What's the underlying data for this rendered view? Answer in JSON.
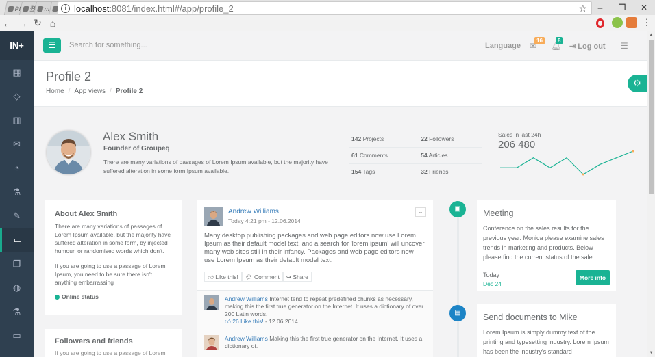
{
  "browser": {
    "tabs": [
      "PI",
      "登",
      "m",
      "M",
      "R",
      "R",
      "R",
      "re",
      "G",
      "器",
      "亞",
      "lo",
      "用",
      "才",
      "[",
      "P",
      "b",
      "1",
      "sc",
      "pi",
      "lo",
      "lo",
      "b",
      "b",
      "4",
      "IN",
      "IN",
      "In",
      "In",
      "IN",
      "In",
      "In",
      "Ir",
      "登"
    ],
    "active_tab_close": "×",
    "url_host": "localhost",
    "url_rest_port": ":8081",
    "url_path": "/index.html#/app/profile_2"
  },
  "app": {
    "logo": "IN+",
    "search_placeholder": "Search for something...",
    "language": "Language",
    "mail_count": "16",
    "bell_count": "8",
    "logout": "Log out"
  },
  "page": {
    "title": "Profile 2",
    "breadcrumb": [
      "Home",
      "App views",
      "Profile 2"
    ]
  },
  "profile": {
    "name": "Alex Smith",
    "role": "Founder of Groupeq",
    "description": "There are many variations of passages of Lorem Ipsum available, but the majority have suffered alteration in some form Ipsum available.",
    "stats": [
      {
        "num": "142",
        "label": "Projects"
      },
      {
        "num": "22",
        "label": "Followers"
      },
      {
        "num": "61",
        "label": "Comments"
      },
      {
        "num": "54",
        "label": "Articles"
      },
      {
        "num": "154",
        "label": "Tags"
      },
      {
        "num": "32",
        "label": "Friends"
      }
    ],
    "sales_label": "Sales in last 24h",
    "sales_value": "206 480"
  },
  "sparkline": {
    "values": [
      5,
      5,
      8,
      5,
      8,
      3,
      6,
      8,
      10
    ]
  },
  "about": {
    "title": "About Alex Smith",
    "p1": "There are many variations of passages of Lorem Ipsum available, but the majority have suffered alteration in some form, by injected humour, or randomised words which don't.",
    "p2": "If you are going to use a passage of Lorem Ipsum, you need to be sure there isn't anything embarrassing",
    "status": "Online status"
  },
  "followers": {
    "title": "Followers and friends",
    "text": "If you are going to use a passage of Lorem"
  },
  "post": {
    "author": "Andrew Williams",
    "time": "Today 4:21 pm - 12.06.2014",
    "body": "Many desktop publishing packages and web page editors now use Lorem Ipsum as their default model text, and a search for 'lorem ipsum' will uncover many web sites still in their infancy. Packages and web page editors now use Lorem Ipsum as their default model text.",
    "actions": [
      "Like this!",
      "Comment",
      "Share"
    ],
    "comments": [
      {
        "author": "Andrew Williams",
        "text": "Internet tend to repeat predefined chunks as necessary, making this the first true generator on the Internet. It uses a dictionary of over 200 Latin words.",
        "likes": "26 Like this!",
        "date": "12.06.2014"
      },
      {
        "author": "Andrew Williams",
        "text": "Making this the first true generator on the Internet. It uses a dictionary of.",
        "likes": "",
        "date": ""
      }
    ]
  },
  "timeline": [
    {
      "title": "Meeting",
      "text": "Conference on the sales results for the previous year. Monica please examine sales trends in marketing and products. Below please find the current status of the sale.",
      "day": "Today",
      "date": "Dec 24",
      "button": "More info"
    },
    {
      "title": "Send documents to Mike",
      "text": "Lorem Ipsum is simply dummy text of the printing and typesetting industry. Lorem Ipsum has been the industry's standard"
    }
  ],
  "colors": {
    "accent": "#1ab394",
    "sidebar": "#2f4050",
    "link": "#337ab7",
    "blue": "#1c84c6"
  }
}
